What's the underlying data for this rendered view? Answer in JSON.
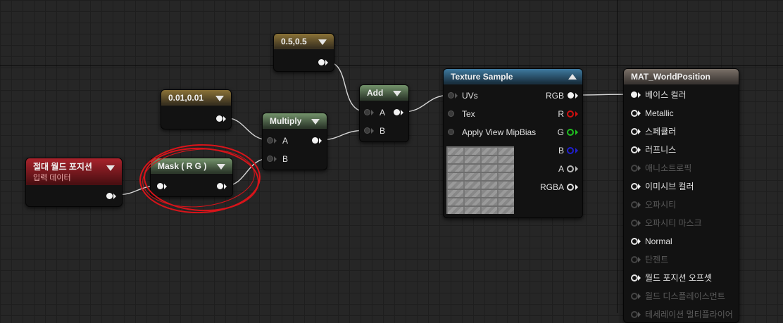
{
  "nodes": {
    "const_half": {
      "title": "0.5,0.5"
    },
    "const_small": {
      "title": "0.01,0.01"
    },
    "absolute_world_position": {
      "title": "절대 월드 포지션",
      "subtitle": "입력 데이터"
    },
    "mask": {
      "title": "Mask ( R G )"
    },
    "multiply": {
      "title": "Multiply",
      "pins": {
        "a": "A",
        "b": "B"
      }
    },
    "add": {
      "title": "Add",
      "pins": {
        "a": "A",
        "b": "B"
      }
    },
    "texture_sample": {
      "title": "Texture Sample",
      "inputs": [
        "UVs",
        "Tex",
        "Apply View MipBias"
      ],
      "outputs": [
        "RGB",
        "R",
        "G",
        "B",
        "A",
        "RGBA"
      ]
    },
    "material": {
      "title": "MAT_WorldPosition",
      "pins": [
        "베이스 컬러",
        "Metallic",
        "스페큘러",
        "러프니스",
        "애니소트로픽",
        "이미시브 컬러",
        "오파시티",
        "오파시티 마스크",
        "Normal",
        "탄젠트",
        "월드 포지션 오프셋",
        "월드 디스플레이스먼트",
        "테세레이션 멀티플라이어"
      ]
    }
  },
  "colors": {
    "pin_r": "#d01010",
    "pin_g": "#20c020",
    "pin_b": "#2020d0",
    "annotation": "#d8141a"
  }
}
